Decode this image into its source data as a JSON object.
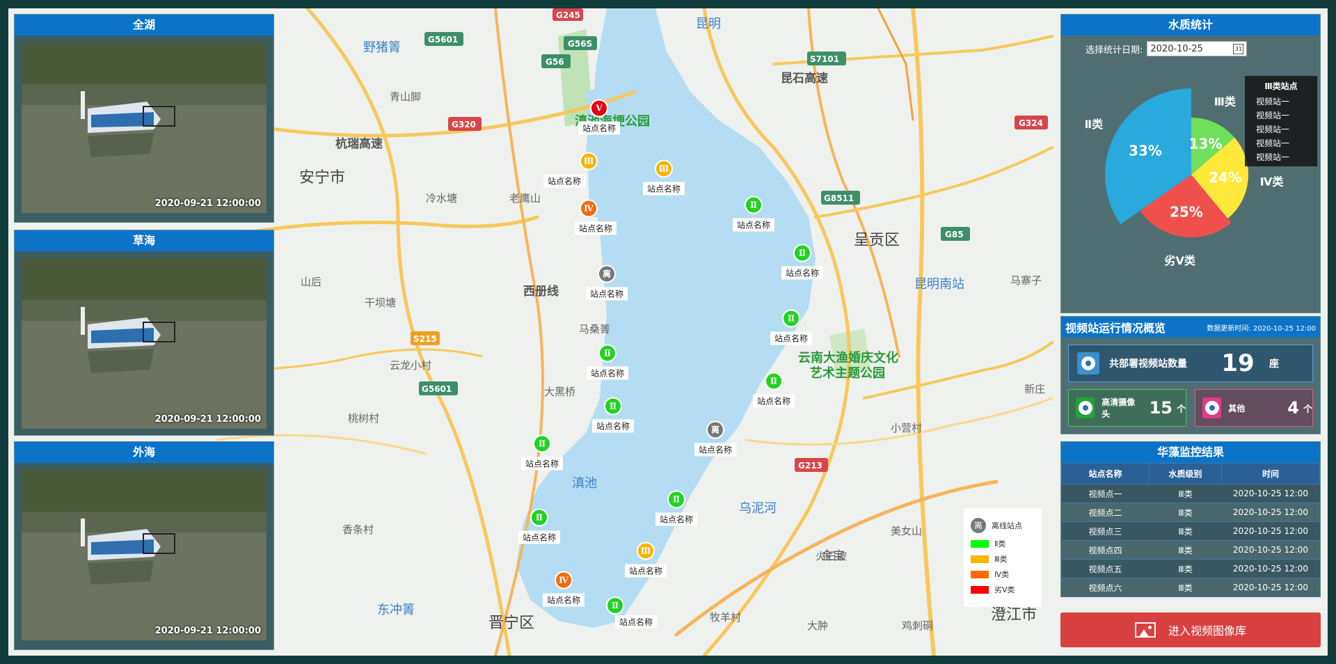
{
  "cameras": [
    {
      "title": "全湖",
      "timestamp": "2020-09-21  12:00:00"
    },
    {
      "title": "草海",
      "timestamp": "2020-09-21  12:00:00"
    },
    {
      "title": "外海",
      "timestamp": "2020-09-21  12:00:00"
    }
  ],
  "map": {
    "places": {
      "kunming": "昆明",
      "anning": "安宁市",
      "chenggong": "呈贡区",
      "jinning": "晋宁区",
      "dianchi": "滇池",
      "kunming_south": "昆明南站",
      "park": "云南大渔婚庆文化",
      "park2": "艺术主题公园",
      "wetland": "滇池海埂公园",
      "dongchong": "东冲箐",
      "yezhujing": "野猪箐",
      "kunyu": "杭瑞高速",
      "xisanxian": "西册线",
      "chengjiang": "澄江市",
      "wunihe": "乌泥河",
      "jinbao": "金宝",
      "kunshi": "昆石高速"
    },
    "roads": [
      "G245",
      "G5601",
      "G56S",
      "G56",
      "G320",
      "S7101",
      "G324",
      "G8511",
      "G85",
      "G213",
      "S215",
      "G5601"
    ],
    "station_label": "站点名称",
    "stations": [
      {
        "grade": "Ⅴ",
        "color": "#e60012"
      },
      {
        "grade": "Ⅲ",
        "color": "#f5b40c"
      },
      {
        "grade": "Ⅳ",
        "color": "#f26b0e"
      },
      {
        "grade": "Ⅲ",
        "color": "#f5b40c"
      },
      {
        "grade": "Ⅱ",
        "color": "#20d320"
      },
      {
        "grade": "离",
        "color": "#777777"
      },
      {
        "grade": "Ⅱ",
        "color": "#20d320"
      },
      {
        "grade": "Ⅱ",
        "color": "#20d320"
      },
      {
        "grade": "Ⅱ",
        "color": "#20d320"
      },
      {
        "grade": "Ⅱ",
        "color": "#20d320"
      },
      {
        "grade": "Ⅱ",
        "color": "#20d320"
      },
      {
        "grade": "离",
        "color": "#777777"
      },
      {
        "grade": "Ⅱ",
        "color": "#20d320"
      },
      {
        "grade": "Ⅱ",
        "color": "#20d320"
      },
      {
        "grade": "Ⅱ",
        "color": "#20d320"
      },
      {
        "grade": "Ⅲ",
        "color": "#f5b40c"
      },
      {
        "grade": "Ⅳ",
        "color": "#f26b0e"
      },
      {
        "grade": "Ⅱ",
        "color": "#20d320"
      }
    ],
    "legend": {
      "offline": "离线站点",
      "offline_symbol": "离",
      "items": [
        {
          "label": "Ⅱ类",
          "color": "#00ff00"
        },
        {
          "label": "Ⅲ类",
          "color": "#ffb400"
        },
        {
          "label": "Ⅳ类",
          "color": "#ff6a00"
        },
        {
          "label": "劣Ⅴ类",
          "color": "#ff0000"
        }
      ]
    }
  },
  "water_quality": {
    "title": "水质统计",
    "date_label": "选择统计日期:",
    "date_value": "2020-10-25",
    "calendar_icon": "31",
    "chart_data": {
      "type": "pie",
      "slices": [
        {
          "name": "Ⅱ类",
          "value": 33,
          "label": "33%",
          "color": "#29a9dc"
        },
        {
          "name": "Ⅲ类",
          "value": 13,
          "label": "13%",
          "color": "#6ee05a"
        },
        {
          "name": "Ⅳ类",
          "value": 24,
          "label": "24%",
          "color": "#ffe83a"
        },
        {
          "name": "劣Ⅴ类",
          "value": 25,
          "label": "25%",
          "color": "#f0504c"
        }
      ]
    },
    "tooltip": {
      "title": "Ⅲ类站点",
      "items": [
        "视频站一",
        "视频站一",
        "视频站一",
        "视频站一",
        "视频站一"
      ]
    }
  },
  "overview": {
    "title": "视频站运行情况概览",
    "update_label": "数据更新时间:",
    "update_time": "2020-10-25  12:00",
    "total_label": "共部署视频站数量",
    "total_value": "19",
    "total_unit": "座",
    "hd_label": "高清摄像头",
    "hd_value": "15",
    "hd_unit": "个",
    "other_label": "其他",
    "other_value": "4",
    "other_unit": "个",
    "colors": {
      "total_icon": "#3a8fcf",
      "hd_icon": "#1fa43a",
      "other_icon": "#e23b8e"
    }
  },
  "algae": {
    "title": "华藻监控结果",
    "columns": [
      "站点名称",
      "水质级别",
      "时间"
    ],
    "rows": [
      [
        "视频点一",
        "Ⅲ类",
        "2020-10-25  12:00"
      ],
      [
        "视频点二",
        "Ⅲ类",
        "2020-10-25  12:00"
      ],
      [
        "视频点三",
        "Ⅲ类",
        "2020-10-25  12:00"
      ],
      [
        "视频点四",
        "Ⅲ类",
        "2020-10-25  12:00"
      ],
      [
        "视频点五",
        "Ⅲ类",
        "2020-10-25  12:00"
      ],
      [
        "视频点六",
        "Ⅲ类",
        "2020-10-25  12:00"
      ]
    ]
  },
  "gallery_button": "进入视频图像库"
}
